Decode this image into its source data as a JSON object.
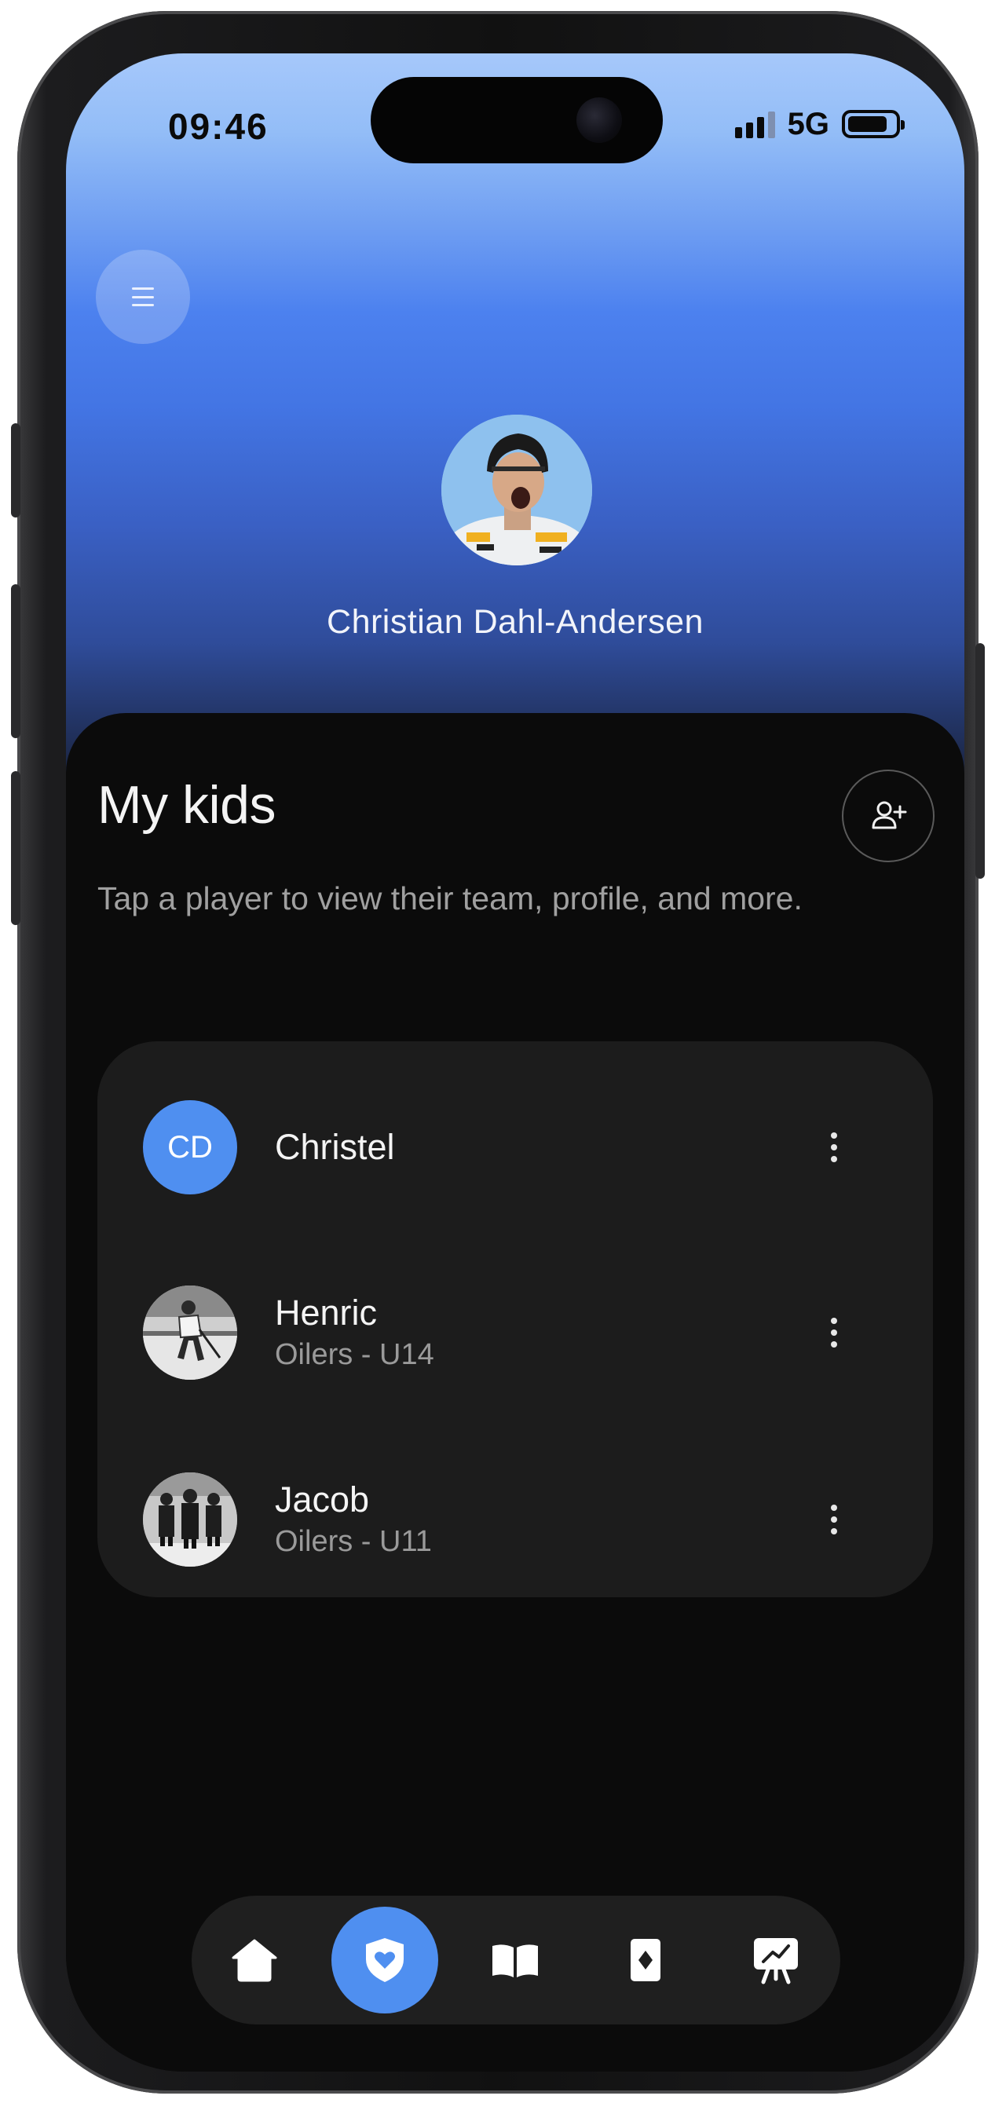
{
  "status_bar": {
    "time": "09:46",
    "network": "5G",
    "signal_bars": 3,
    "battery_percent": 85
  },
  "header": {
    "menu_icon": "menu-icon",
    "profile_name": "Christian Dahl-Andersen"
  },
  "kids_section": {
    "title": "My kids",
    "description": "Tap a player to view their team, profile, and more.",
    "add_icon": "add-user-icon",
    "kids": [
      {
        "initials": "CD",
        "name": "Christel",
        "team": ""
      },
      {
        "name": "Henric",
        "team": "Oilers - U14"
      },
      {
        "name": "Jacob",
        "team": "Oilers - U11"
      }
    ]
  },
  "bottom_nav": {
    "items": [
      {
        "icon": "home-icon",
        "active": false
      },
      {
        "icon": "shield-heart-icon",
        "active": true
      },
      {
        "icon": "book-icon",
        "active": false
      },
      {
        "icon": "card-icon",
        "active": false
      },
      {
        "icon": "presentation-board-icon",
        "active": false
      }
    ]
  },
  "colors": {
    "accent": "#4f8ff0",
    "background": "#0b0b0b",
    "card": "#1c1c1c",
    "header_gradient_top": "#a6c8fb",
    "header_gradient_mid": "#4375e4"
  }
}
